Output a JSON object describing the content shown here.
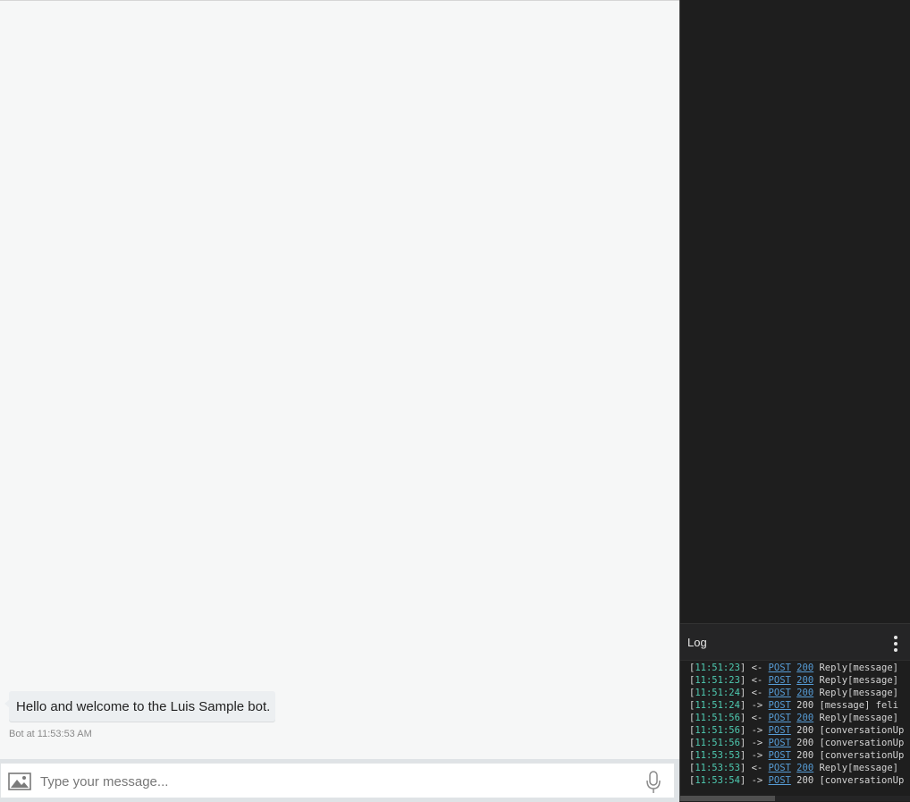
{
  "chat": {
    "messages": [
      {
        "text": "Hello and welcome to the Luis Sample bot.",
        "timestamp": "Bot at 11:53:53 AM"
      }
    ],
    "composer": {
      "placeholder": "Type your message..."
    },
    "icons": {
      "upload": "image-upload-icon",
      "mic": "microphone-icon"
    }
  },
  "log": {
    "title": "Log",
    "menu_icon": "more-vertical-icon",
    "lines": [
      {
        "time": "11:51:23",
        "dir": "<-",
        "method": "POST",
        "status": "200",
        "status_link": true,
        "detail": "Reply[message]"
      },
      {
        "time": "11:51:23",
        "dir": "<-",
        "method": "POST",
        "status": "200",
        "status_link": true,
        "detail": "Reply[message]"
      },
      {
        "time": "11:51:24",
        "dir": "<-",
        "method": "POST",
        "status": "200",
        "status_link": true,
        "detail": "Reply[message]"
      },
      {
        "time": "11:51:24",
        "dir": "->",
        "method": "POST",
        "status": "200",
        "status_link": false,
        "detail": "[message] feli"
      },
      {
        "time": "11:51:56",
        "dir": "<-",
        "method": "POST",
        "status": "200",
        "status_link": true,
        "detail": "Reply[message]"
      },
      {
        "time": "11:51:56",
        "dir": "->",
        "method": "POST",
        "status": "200",
        "status_link": false,
        "detail": "[conversationUp"
      },
      {
        "time": "11:51:56",
        "dir": "->",
        "method": "POST",
        "status": "200",
        "status_link": false,
        "detail": "[conversationUp"
      },
      {
        "time": "11:53:53",
        "dir": "->",
        "method": "POST",
        "status": "200",
        "status_link": false,
        "detail": "[conversationUp"
      },
      {
        "time": "11:53:53",
        "dir": "<-",
        "method": "POST",
        "status": "200",
        "status_link": true,
        "detail": "Reply[message]"
      },
      {
        "time": "11:53:54",
        "dir": "->",
        "method": "POST",
        "status": "200",
        "status_link": false,
        "detail": "[conversationUp"
      }
    ]
  },
  "colors": {
    "chat_bg": "#f6f7f7",
    "log_bg": "#1e1e1e",
    "log_timestamp": "#4ec9b0",
    "log_link": "#569cd6",
    "log_text": "#d4d4d4"
  }
}
